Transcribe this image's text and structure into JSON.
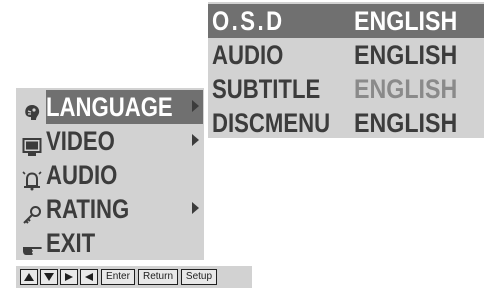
{
  "submenu": {
    "rows": [
      {
        "key": "O.S.D",
        "value": "ENGLISH"
      },
      {
        "key": "AUDIO",
        "value": "ENGLISH"
      },
      {
        "key": "SUBTITLE",
        "value": "ENGLISH"
      },
      {
        "key": "DISCMENU",
        "value": "ENGLISH"
      }
    ]
  },
  "mainmenu": {
    "items": [
      {
        "label": "LANGUAGE",
        "icon": "language-face-icon",
        "has_submenu": true,
        "selected": true
      },
      {
        "label": "VIDEO",
        "icon": "monitor-icon",
        "has_submenu": true
      },
      {
        "label": "AUDIO",
        "icon": "bell-icon",
        "has_submenu": false
      },
      {
        "label": "RATING",
        "icon": "key-icon",
        "has_submenu": true
      },
      {
        "label": "EXIT",
        "icon": "pointing-hand-icon",
        "has_submenu": false
      }
    ]
  },
  "keybar": {
    "keys": [
      {
        "icon": "up-arrow-icon"
      },
      {
        "icon": "down-arrow-icon"
      },
      {
        "icon": "right-arrow-icon"
      },
      {
        "icon": "left-arrow-icon"
      },
      {
        "label": "Enter"
      },
      {
        "label": "Return"
      },
      {
        "label": "Setup"
      }
    ]
  },
  "colors": {
    "panel": "#d2d2d2",
    "highlight": "#707070",
    "text": "#3c3c3c",
    "highlight_text": "#ffffff"
  }
}
